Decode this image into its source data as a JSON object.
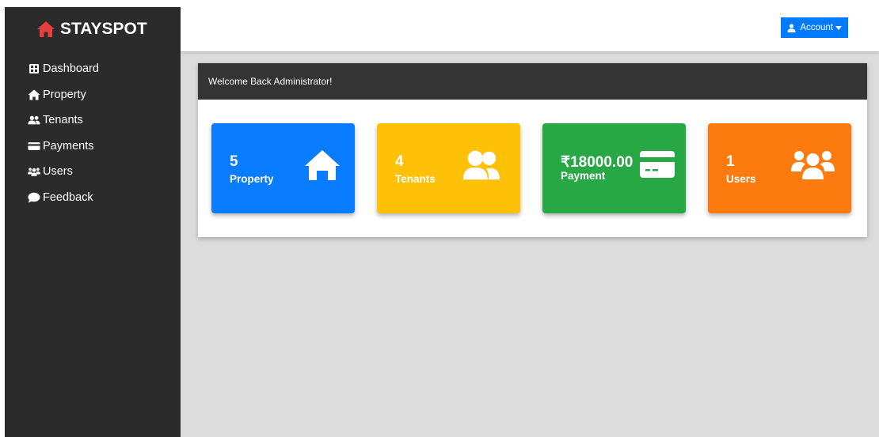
{
  "brand": {
    "name": "STAYSPOT",
    "logo_icon": "home-icon",
    "logo_color": "#e83e3e"
  },
  "sidebar": {
    "items": [
      {
        "label": "Dashboard",
        "icon": "dashboard-icon"
      },
      {
        "label": "Property",
        "icon": "home-icon"
      },
      {
        "label": "Tenants",
        "icon": "user-pair-icon"
      },
      {
        "label": "Payments",
        "icon": "credit-card-icon"
      },
      {
        "label": "Users",
        "icon": "users-group-icon"
      },
      {
        "label": "Feedback",
        "icon": "comment-icon"
      }
    ]
  },
  "header": {
    "account_label": "Account",
    "account_icon": "user-icon"
  },
  "welcome": {
    "title": "Welcome Back Administrator!"
  },
  "stats": [
    {
      "value": "5",
      "label": "Property",
      "color": "#0a7cff",
      "icon": "home-icon"
    },
    {
      "value": "4",
      "label": "Tenants",
      "color": "#ffc107",
      "icon": "user-pair-icon"
    },
    {
      "value": "₹18000.00",
      "label": "Payment",
      "color": "#28a745",
      "icon": "credit-card-icon"
    },
    {
      "value": "1",
      "label": "Users",
      "color": "#fd7a0e",
      "icon": "users-group-icon"
    }
  ]
}
